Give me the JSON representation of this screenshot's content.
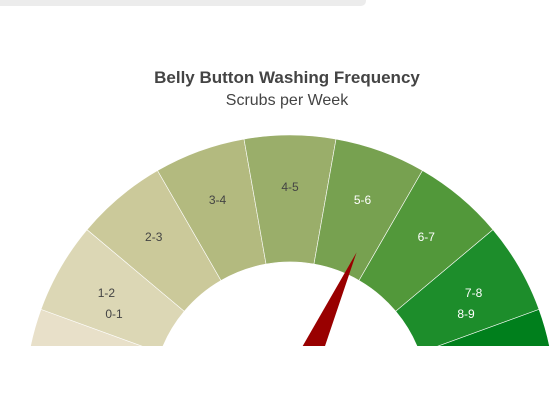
{
  "chart_data": {
    "type": "gauge",
    "title": "Belly Button Washing Frequency",
    "subtitle": "Scrubs per Week",
    "range": [
      0,
      9
    ],
    "segments": [
      {
        "label": "0-1",
        "color": "#e8e0c9",
        "label_color": "#444444"
      },
      {
        "label": "1-2",
        "color": "#dcd7b5",
        "label_color": "#444444"
      },
      {
        "label": "2-3",
        "color": "#cbc99a",
        "label_color": "#444444"
      },
      {
        "label": "3-4",
        "color": "#b3ba7f",
        "label_color": "#444444"
      },
      {
        "label": "4-5",
        "color": "#9aae6a",
        "label_color": "#444444"
      },
      {
        "label": "5-6",
        "color": "#77a150",
        "label_color": "#ffffff"
      },
      {
        "label": "6-7",
        "color": "#52983a",
        "label_color": "#ffffff"
      },
      {
        "label": "7-8",
        "color": "#1d8d2b",
        "label_color": "#ffffff"
      },
      {
        "label": "8-9",
        "color": "#007f1c",
        "label_color": "#ffffff"
      }
    ],
    "needle_value": 6,
    "needle_color": "#990000"
  }
}
